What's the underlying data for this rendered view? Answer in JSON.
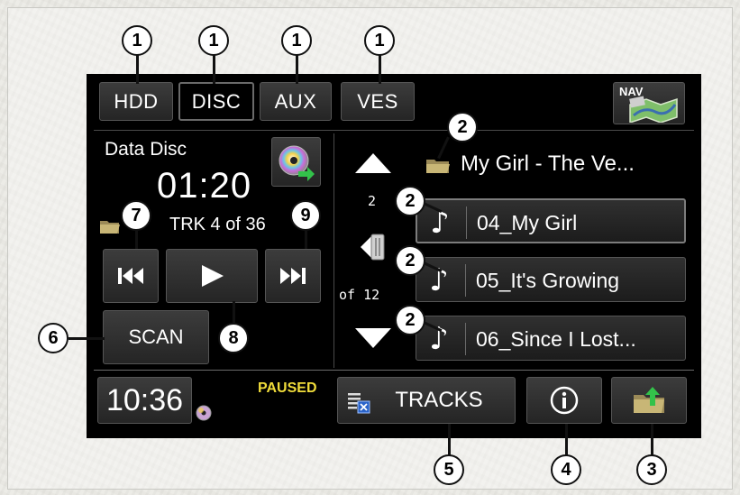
{
  "tabs": [
    {
      "label": "HDD",
      "active": false
    },
    {
      "label": "DISC",
      "active": true
    },
    {
      "label": "AUX",
      "active": false
    },
    {
      "label": "VES",
      "active": false
    }
  ],
  "nav_label": "NAV",
  "disc": {
    "title": "Data Disc",
    "time": "01:20",
    "track_info": "TRK 4 of 36"
  },
  "scan_label": "SCAN",
  "folder_name": "My Girl - The Ve...",
  "list": {
    "position_top": "2",
    "position_bottom": "of 12"
  },
  "tracks": [
    {
      "label": "04_My Girl",
      "selected": true
    },
    {
      "label": "05_It's Growing",
      "selected": false
    },
    {
      "label": "06_Since I Lost...",
      "selected": false
    }
  ],
  "clock": "10:36",
  "status": "PAUSED",
  "tracks_button_label": "TRACKS",
  "colors": {
    "paused": "#f0dc3a",
    "accent_green": "#33c24a"
  },
  "icons": {
    "eject": "eject-disc-icon",
    "prev": "skip-previous-icon",
    "play": "play-icon",
    "next": "skip-next-icon",
    "up": "up-arrow-icon",
    "down": "down-arrow-icon",
    "info": "info-icon",
    "folder_up": "folder-up-icon",
    "nav": "map-icon",
    "note": "music-note-icon",
    "tracks": "track-list-icon",
    "folder": "folder-icon",
    "disc": "disc-icon"
  },
  "callouts": {
    "tabs": "1",
    "folder": "2",
    "track": "2",
    "next_track": "2",
    "last_track": "2",
    "folder_up": "3",
    "info": "4",
    "tracks": "5",
    "scan": "6",
    "prev": "7",
    "play": "8",
    "next": "9"
  }
}
